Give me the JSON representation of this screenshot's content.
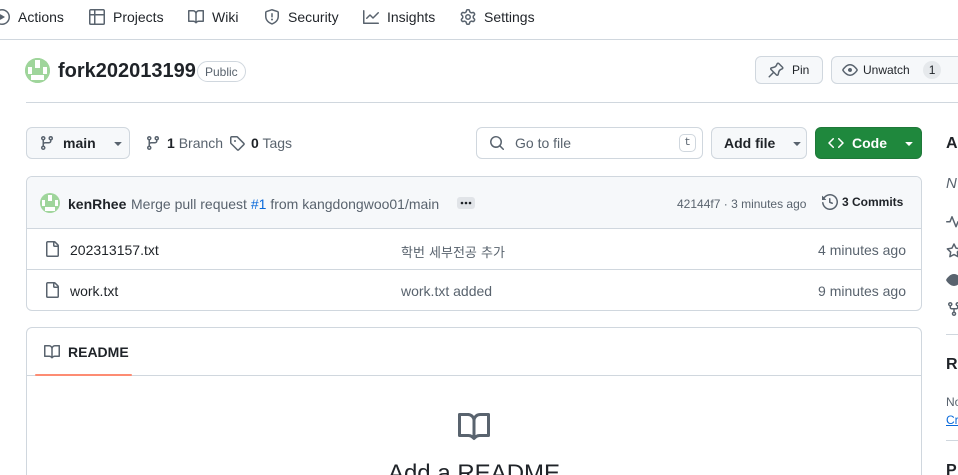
{
  "nav": {
    "items": [
      {
        "label": "Actions",
        "icon": "play-icon"
      },
      {
        "label": "Projects",
        "icon": "table-icon"
      },
      {
        "label": "Wiki",
        "icon": "book-icon"
      },
      {
        "label": "Security",
        "icon": "shield-icon"
      },
      {
        "label": "Insights",
        "icon": "graph-icon"
      },
      {
        "label": "Settings",
        "icon": "gear-icon"
      }
    ]
  },
  "repo": {
    "name": "fork202013199",
    "visibility": "Public",
    "pin_label": "Pin",
    "unwatch_label": "Unwatch",
    "watch_count": "1"
  },
  "branch_bar": {
    "branch": "main",
    "branch_count": "1",
    "branch_word": "Branch",
    "tag_count": "0",
    "tag_word": "Tags",
    "search_placeholder": "Go to file",
    "search_shortcut": "t",
    "add_file_label": "Add file",
    "code_label": "Code"
  },
  "commit": {
    "author": "kenRhee",
    "message_prefix": "Merge pull request",
    "pr_link": "#1",
    "message_suffix": "from kangdongwoo01/main",
    "sha": "42144f7",
    "time": "· 3 minutes ago",
    "commits_label": "3 Commits"
  },
  "files": [
    {
      "name": "202313157.txt",
      "message": "학번 세부전공 추가",
      "time": "4 minutes ago"
    },
    {
      "name": "work.txt",
      "message": "work.txt added",
      "time": "9 minutes ago"
    }
  ],
  "readme": {
    "tab_label": "README",
    "heading": "Add a README"
  },
  "sidebar": {
    "about_letter": "A",
    "desc_letter": "N",
    "releases_letter": "R",
    "releases_no": "No",
    "create_link": "Cr",
    "packages_letter": "P"
  },
  "colors": {
    "accent_green": "#1f883d",
    "underline": "#fd8c73",
    "link_blue": "#0969da",
    "border": "#d0d7de"
  }
}
